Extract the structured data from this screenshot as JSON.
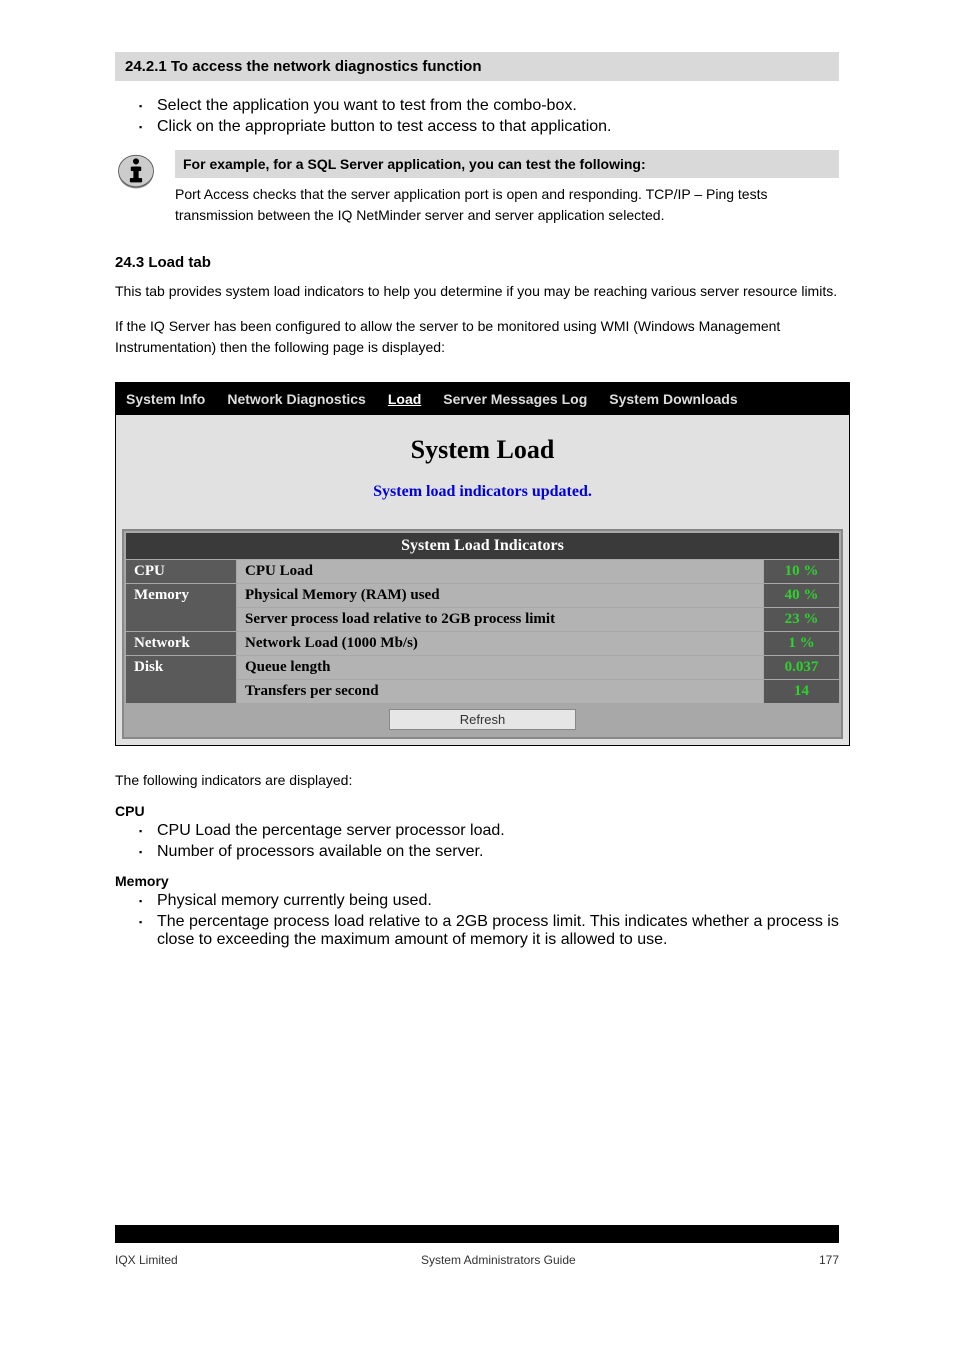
{
  "section1": {
    "header": "24.2.1 To access the network diagnostics function",
    "bullets": [
      "Select the application you want to test from the combo-box.",
      "Click on the appropriate button to test access to that application."
    ]
  },
  "info": {
    "bar": "For example, for a SQL Server application, you can test the following:",
    "body": "Port Access checks that the server application port is open and responding. TCP/IP – Ping tests transmission between the IQ NetMinder server and server application selected."
  },
  "section2": {
    "number_title": "24.3 Load tab",
    "body_1": "This tab provides system load indicators to help you determine if you may be reaching various server resource limits.",
    "body_2": "If the IQ Server has been configured to allow the server to be monitored using WMI (Windows Management Instrumentation) then the following page is displayed:"
  },
  "screenshot": {
    "tabs": [
      "System Info",
      "Network Diagnostics",
      "Load",
      "Server Messages Log",
      "System Downloads"
    ],
    "active_tab": "Load",
    "title": "System Load",
    "status": "System load indicators updated.",
    "table_title": "System Load Indicators",
    "rows": [
      {
        "cat": "CPU",
        "label": "CPU Load",
        "val": "10 %"
      },
      {
        "cat": "Memory",
        "label": "Physical Memory (RAM) used",
        "val": "40 %"
      },
      {
        "cat": "",
        "label": "Server process load relative to 2GB process limit",
        "val": "23 %"
      },
      {
        "cat": "Network",
        "label": "Network Load (1000 Mb/s)",
        "val": "1 %"
      },
      {
        "cat": "Disk",
        "label": "Queue length",
        "val": "0.037"
      },
      {
        "cat": "",
        "label": "Transfers per second",
        "val": "14"
      }
    ],
    "refresh": "Refresh"
  },
  "after": {
    "intro": "The following indicators are displayed:",
    "cpu_label": "CPU",
    "cpu_bullets": [
      "CPU Load the percentage server processor load.",
      "Number of processors available on the server."
    ],
    "mem_label": "Memory",
    "mem_bullets": [
      "Physical memory currently being used.",
      "The percentage process load relative to a 2GB process limit. This indicates whether a process is close to exceeding the maximum amount of memory it is allowed to use."
    ]
  },
  "footer": {
    "left": "IQX Limited",
    "center": "System Administrators Guide",
    "right": "177"
  }
}
